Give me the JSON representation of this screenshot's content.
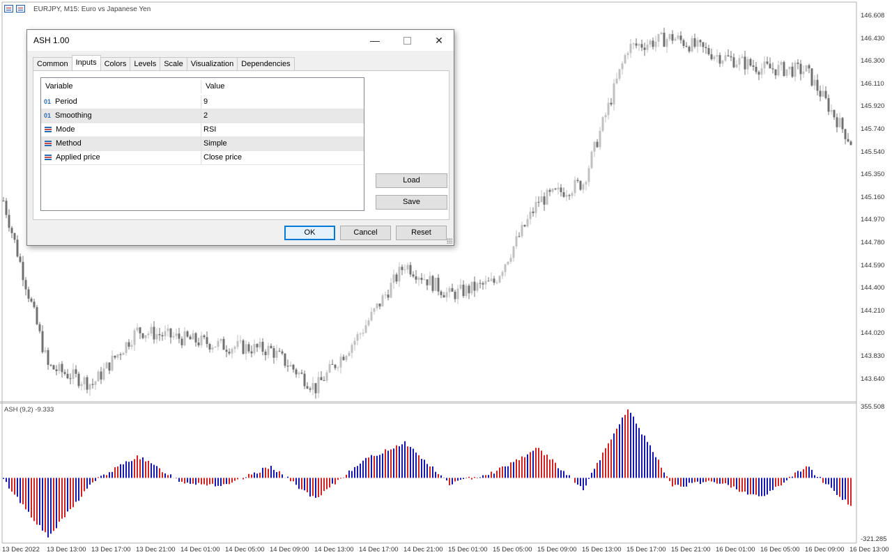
{
  "chart": {
    "title": "EURJPY, M15:  Euro vs Japanese Yen",
    "price_axis": [
      "146.608",
      "146.430",
      "146.300",
      "146.110",
      "145.920",
      "145.740",
      "145.540",
      "145.350",
      "145.160",
      "144.970",
      "144.780",
      "144.590",
      "144.400",
      "144.210",
      "144.020",
      "143.830",
      "143.640"
    ],
    "time_axis": [
      "13 Dec 2022",
      "13 Dec 13:00",
      "13 Dec 17:00",
      "13 Dec 21:00",
      "14 Dec 01:00",
      "14 Dec 05:00",
      "14 Dec 09:00",
      "14 Dec 13:00",
      "14 Dec 17:00",
      "14 Dec 21:00",
      "15 Dec 01:00",
      "15 Dec 05:00",
      "15 Dec 09:00",
      "15 Dec 13:00",
      "15 Dec 17:00",
      "15 Dec 21:00",
      "16 Dec 01:00",
      "16 Dec 05:00",
      "16 Dec 09:00",
      "16 Dec 13:00"
    ],
    "colors": {
      "bull_candle": "#c0c0c0",
      "bear_candle": "#707070",
      "hist_blue": "#1515b0",
      "hist_red": "#d21f1f",
      "grid": "#d9d9d9"
    }
  },
  "chart_data": {
    "type": "candlestick",
    "close_keypoints": [
      {
        "t": "13 Dec 2022",
        "c": 145.16
      },
      {
        "t": "13 Dec 13:00",
        "c": 143.86
      },
      {
        "t": "13 Dec 17:00",
        "c": 143.72
      },
      {
        "t": "13 Dec 21:00",
        "c": 144.14
      },
      {
        "t": "14 Dec 01:00",
        "c": 144.08
      },
      {
        "t": "14 Dec 05:00",
        "c": 144.02
      },
      {
        "t": "14 Dec 09:00",
        "c": 143.99
      },
      {
        "t": "14 Dec 13:00",
        "c": 143.69
      },
      {
        "t": "14 Dec 17:00",
        "c": 144.12
      },
      {
        "t": "14 Dec 21:00",
        "c": 144.66
      },
      {
        "t": "15 Dec 01:00",
        "c": 144.42
      },
      {
        "t": "15 Dec 05:00",
        "c": 144.52
      },
      {
        "t": "15 Dec 09:00",
        "c": 145.16
      },
      {
        "t": "15 Dec 13:00",
        "c": 145.3
      },
      {
        "t": "15 Dec 17:00",
        "c": 146.36
      },
      {
        "t": "15 Dec 21:00",
        "c": 146.44
      },
      {
        "t": "16 Dec 01:00",
        "c": 146.3
      },
      {
        "t": "16 Dec 05:00",
        "c": 146.2
      },
      {
        "t": "16 Dec 09:00",
        "c": 146.18
      },
      {
        "t": "16 Dec 13:00",
        "c": 145.62
      }
    ],
    "indicator": {
      "label": "ASH (9,2) -9.333",
      "scale_max": "355.508",
      "scale_min": "-321.285",
      "keypoints": [
        {
          "t": "13 Dec 2022",
          "v": -10
        },
        {
          "t": "13 Dec 13:00",
          "v": -300
        },
        {
          "t": "13 Dec 17:00",
          "v": -20
        },
        {
          "t": "13 Dec 21:00",
          "v": 110
        },
        {
          "t": "14 Dec 01:00",
          "v": -20
        },
        {
          "t": "14 Dec 05:00",
          "v": -40
        },
        {
          "t": "14 Dec 09:00",
          "v": 60
        },
        {
          "t": "14 Dec 13:00",
          "v": -110
        },
        {
          "t": "14 Dec 17:00",
          "v": 80
        },
        {
          "t": "14 Dec 21:00",
          "v": 180
        },
        {
          "t": "15 Dec 01:00",
          "v": -30
        },
        {
          "t": "15 Dec 05:00",
          "v": 30
        },
        {
          "t": "15 Dec 09:00",
          "v": 150
        },
        {
          "t": "15 Dec 13:00",
          "v": -60
        },
        {
          "t": "15 Dec 17:00",
          "v": 350
        },
        {
          "t": "15 Dec 21:00",
          "v": -40
        },
        {
          "t": "16 Dec 01:00",
          "v": -20
        },
        {
          "t": "16 Dec 05:00",
          "v": -100
        },
        {
          "t": "16 Dec 09:00",
          "v": 60
        },
        {
          "t": "16 Dec 13:00",
          "v": -140
        }
      ]
    }
  },
  "dialog": {
    "title": "ASH 1.00",
    "tabs": [
      "Common",
      "Inputs",
      "Colors",
      "Levels",
      "Scale",
      "Visualization",
      "Dependencies"
    ],
    "active_tab": "Inputs",
    "grid_headers": {
      "variable": "Variable",
      "value": "Value"
    },
    "rows": [
      {
        "icon": "number-icon",
        "icon_text": "01",
        "variable": "Period",
        "value": "9"
      },
      {
        "icon": "number-icon",
        "icon_text": "01",
        "variable": "Smoothing",
        "value": "2"
      },
      {
        "icon": "list-icon",
        "variable": "Mode",
        "value": "RSI"
      },
      {
        "icon": "list-icon",
        "variable": "Method",
        "value": "Simple"
      },
      {
        "icon": "list-icon",
        "variable": "Applied price",
        "value": "Close price"
      }
    ],
    "load_label": "Load",
    "save_label": "Save",
    "ok_label": "OK",
    "cancel_label": "Cancel",
    "reset_label": "Reset",
    "close_glyph": "✕",
    "min_glyph": "—"
  }
}
